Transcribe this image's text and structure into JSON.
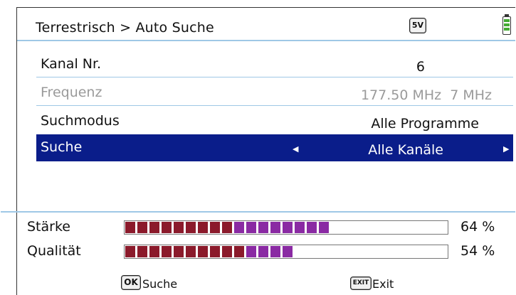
{
  "header": {
    "title": "Terrestrisch > Auto Suche",
    "badge": "5V",
    "battery_icon": "battery-icon"
  },
  "rows": [
    {
      "label": "Kanal Nr.",
      "value": "6",
      "enabled": true
    },
    {
      "label": "Frequenz",
      "value": "177.50 MHz  7 MHz",
      "enabled": false
    },
    {
      "label": "Suchmodus",
      "value": "Alle Programme",
      "enabled": true
    },
    {
      "label": "Suche",
      "value": "Alle Kanäle",
      "enabled": true,
      "selected": true
    }
  ],
  "meters": [
    {
      "label": "Stärke",
      "percent": 64,
      "text": "64 %"
    },
    {
      "label": "Qualität",
      "percent": 54,
      "text": "54 %"
    }
  ],
  "footer": {
    "ok_key": "OK",
    "ok_label": "Suche",
    "exit_key": "EXIT",
    "exit_label": "Exit"
  },
  "colors": {
    "selection": "#0a1d8a",
    "meter_red": "#8b1a2b",
    "meter_purple": "#8a2aa3",
    "divider": "#9fc8e6"
  }
}
